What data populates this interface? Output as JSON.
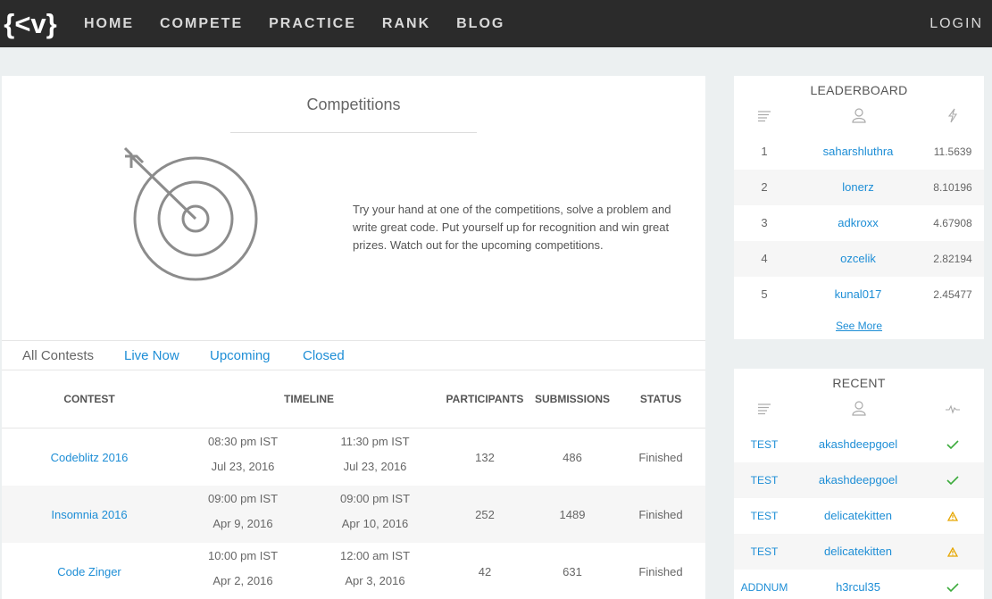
{
  "nav": {
    "logo_text": "{<v}",
    "links": [
      "HOME",
      "COMPETE",
      "PRACTICE",
      "RANK",
      "BLOG"
    ],
    "login": "LOGIN"
  },
  "main": {
    "title": "Competitions",
    "intro": "Try your hand at one of the competitions, solve a problem and write great code. Put yourself up for recognition and win great prizes. Watch out for the upcoming competitions.",
    "tabs": [
      "All Contests",
      "Live Now",
      "Upcoming",
      "Closed"
    ],
    "columns": {
      "contest": "CONTEST",
      "timeline": "TIMELINE",
      "participants": "PARTICIPANTS",
      "submissions": "SUBMISSIONS",
      "status": "STATUS"
    },
    "contests": [
      {
        "name": "Codeblitz 2016",
        "start_time": "08:30 pm IST",
        "start_date": "Jul 23, 2016",
        "end_time": "11:30 pm IST",
        "end_date": "Jul 23, 2016",
        "participants": "132",
        "submissions": "486",
        "status": "Finished"
      },
      {
        "name": "Insomnia 2016",
        "start_time": "09:00 pm IST",
        "start_date": "Apr 9, 2016",
        "end_time": "09:00 pm IST",
        "end_date": "Apr 10, 2016",
        "participants": "252",
        "submissions": "1489",
        "status": "Finished"
      },
      {
        "name": "Code Zinger",
        "start_time": "10:00 pm IST",
        "start_date": "Apr 2, 2016",
        "end_time": "12:00 am IST",
        "end_date": "Apr 3, 2016",
        "participants": "42",
        "submissions": "631",
        "status": "Finished"
      }
    ]
  },
  "leaderboard": {
    "title": "LEADERBOARD",
    "rows": [
      {
        "rank": "1",
        "user": "saharshluthra",
        "score": "11.5639"
      },
      {
        "rank": "2",
        "user": "lonerz",
        "score": "8.10196"
      },
      {
        "rank": "3",
        "user": "adkroxx",
        "score": "4.67908"
      },
      {
        "rank": "4",
        "user": "ozcelik",
        "score": "2.82194"
      },
      {
        "rank": "5",
        "user": "kunal017",
        "score": "2.45477"
      }
    ],
    "see_more": "See More"
  },
  "recent": {
    "title": "RECENT",
    "rows": [
      {
        "problem": "TEST",
        "user": "akashdeepgoel",
        "status": "accepted-check-icon"
      },
      {
        "problem": "TEST",
        "user": "akashdeepgoel",
        "status": "accepted-check-icon"
      },
      {
        "problem": "TEST",
        "user": "delicatekitten",
        "status": "warning-icon"
      },
      {
        "problem": "TEST",
        "user": "delicatekitten",
        "status": "warning-icon"
      },
      {
        "problem": "ADDNUM",
        "user": "h3rcul35",
        "status": "accepted-check-icon"
      }
    ]
  },
  "colors": {
    "navbar": "#2b2b2b",
    "link": "#1e8ed6",
    "accepted": "#3cab3c",
    "warning": "#e6a600"
  }
}
